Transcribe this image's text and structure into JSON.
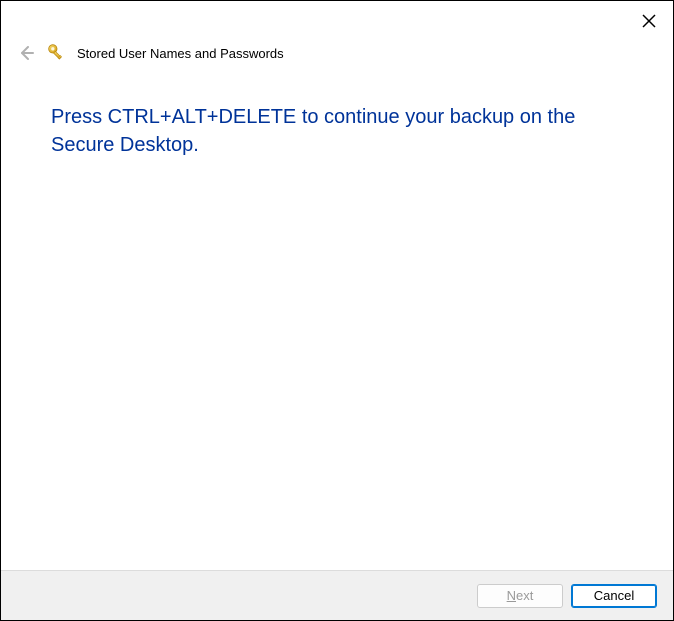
{
  "header": {
    "title": "Stored User Names and Passwords"
  },
  "content": {
    "main_instruction": "Press CTRL+ALT+DELETE to continue your backup on the Secure Desktop."
  },
  "footer": {
    "next_prefix": "N",
    "next_suffix": "ext",
    "cancel_label": "Cancel"
  },
  "colors": {
    "instruction": "#003399",
    "footer_bg": "#f0f0f0",
    "focus_border": "#0078d4"
  }
}
